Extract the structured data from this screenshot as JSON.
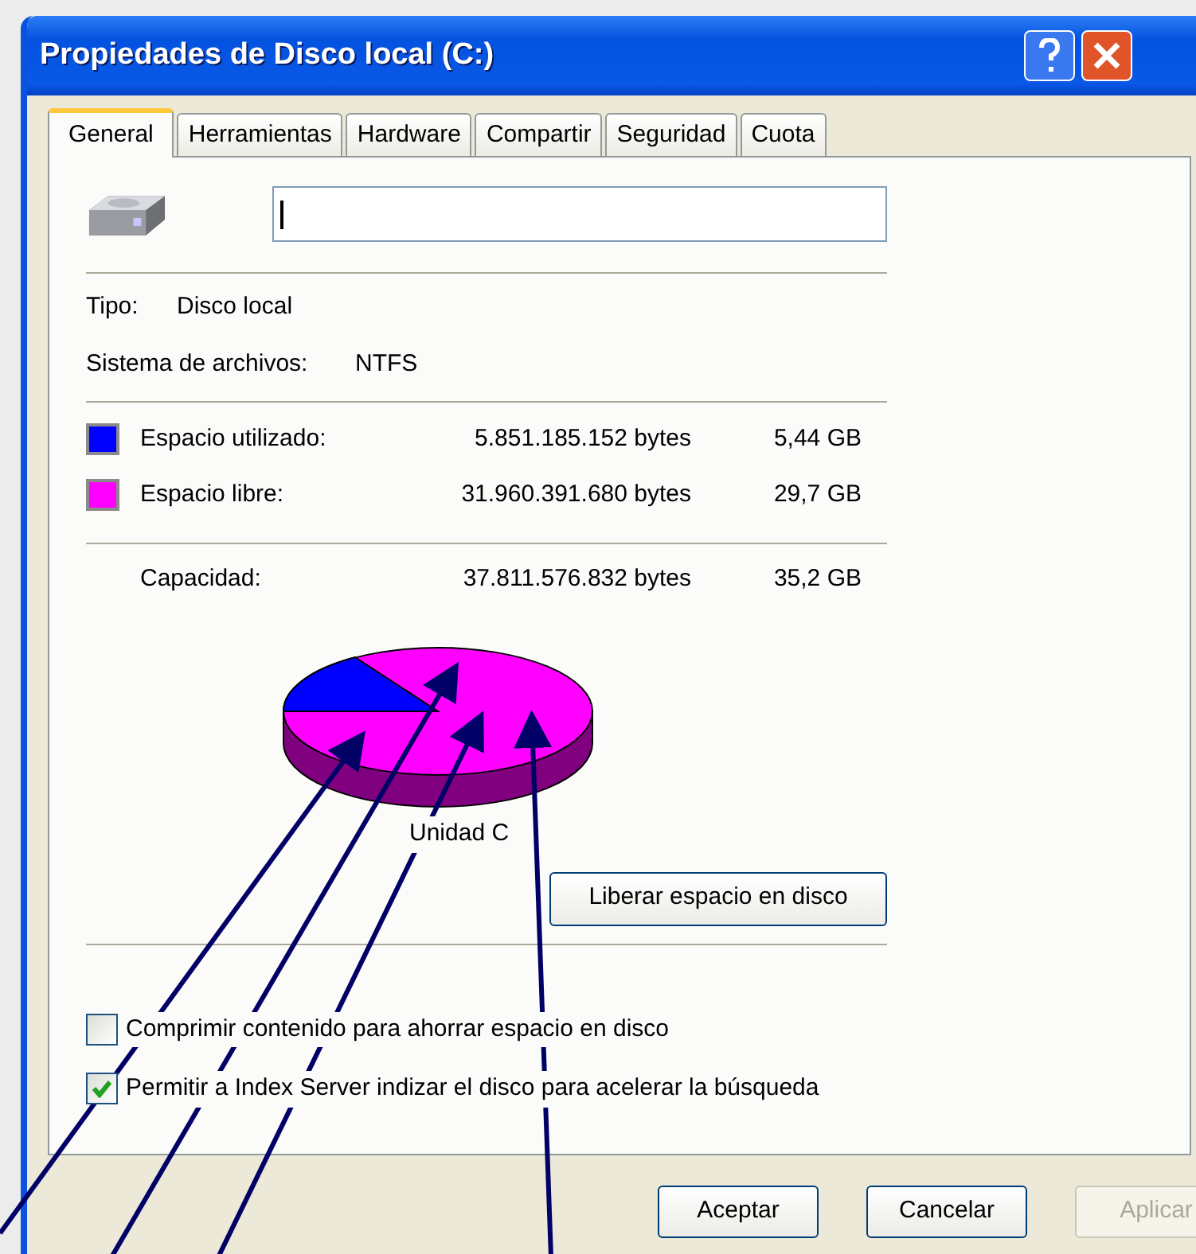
{
  "window": {
    "title": "Propiedades de Disco local (C:)"
  },
  "tabs": [
    {
      "label": "General",
      "selected": true
    },
    {
      "label": "Herramientas",
      "selected": false
    },
    {
      "label": "Hardware",
      "selected": false
    },
    {
      "label": "Compartir",
      "selected": false
    },
    {
      "label": "Seguridad",
      "selected": false
    },
    {
      "label": "Cuota",
      "selected": false
    }
  ],
  "info": [
    {
      "label": "Tipo:",
      "value": "Disco local"
    },
    {
      "label": "Sistema de archivos:",
      "value": "NTFS"
    }
  ],
  "space": [
    {
      "label": "Espacio utilizado:",
      "bytes": "5.851.185.152 bytes",
      "size": "5,44 GB",
      "color": "#0000ff"
    },
    {
      "label": "Espacio libre:",
      "bytes": "31.960.391.680 bytes",
      "size": "29,7 GB",
      "color": "#ff00ff"
    }
  ],
  "capacity": {
    "label": "Capacidad:",
    "bytes": "37.811.576.832 bytes",
    "size": "35,2 GB"
  },
  "drive_label": "Unidad C",
  "cleanup_button": "Liberar espacio en disco",
  "options": [
    {
      "label": "Comprimir contenido para ahorrar espacio en disco",
      "checked": false
    },
    {
      "label": "Permitir a Index Server indizar el disco para acelerar la búsqueda",
      "checked": true
    }
  ],
  "buttons": [
    {
      "label": "Aceptar",
      "disabled": false
    },
    {
      "label": "Cancelar",
      "disabled": false
    },
    {
      "label": "Aplicar",
      "disabled": true
    }
  ]
}
